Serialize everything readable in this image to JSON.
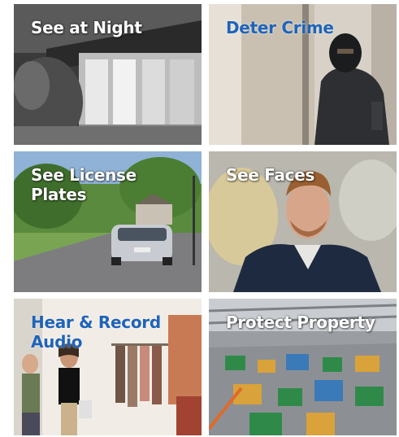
{
  "tiles": [
    {
      "id": "night",
      "label": "See at Night"
    },
    {
      "id": "crime",
      "label": "Deter Crime"
    },
    {
      "id": "plates",
      "label_line1": "See License",
      "label_line2": "Plates"
    },
    {
      "id": "faces",
      "label": "See Faces"
    },
    {
      "id": "audio",
      "label_line1": "Hear & Record",
      "label_line2": "Audio"
    },
    {
      "id": "property",
      "label": "Protect Property"
    }
  ]
}
